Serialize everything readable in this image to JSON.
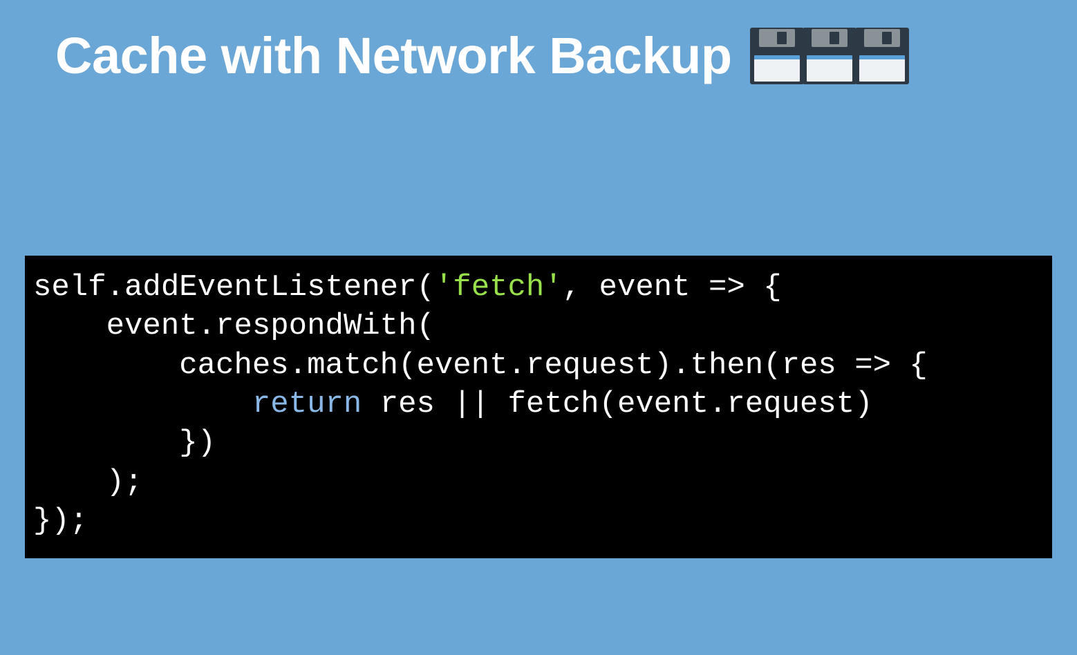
{
  "title": "Cache with Network Backup",
  "icon_semantic": "floppy-disk-icon",
  "icon_count": 3,
  "code": {
    "tokens": [
      {
        "cls": "",
        "text": "self.addEventListener("
      },
      {
        "cls": "tok-str",
        "text": "'fetch'"
      },
      {
        "cls": "",
        "text": ", event => {\n    event.respondWith(\n        caches.match(event.request).then(res => {\n            "
      },
      {
        "cls": "tok-kw",
        "text": "return"
      },
      {
        "cls": "",
        "text": " res || fetch(event.request)\n        })\n    );\n});"
      }
    ],
    "plain": "self.addEventListener('fetch', event => {\n    event.respondWith(\n        caches.match(event.request).then(res => {\n            return res || fetch(event.request)\n        })\n    );\n});"
  }
}
